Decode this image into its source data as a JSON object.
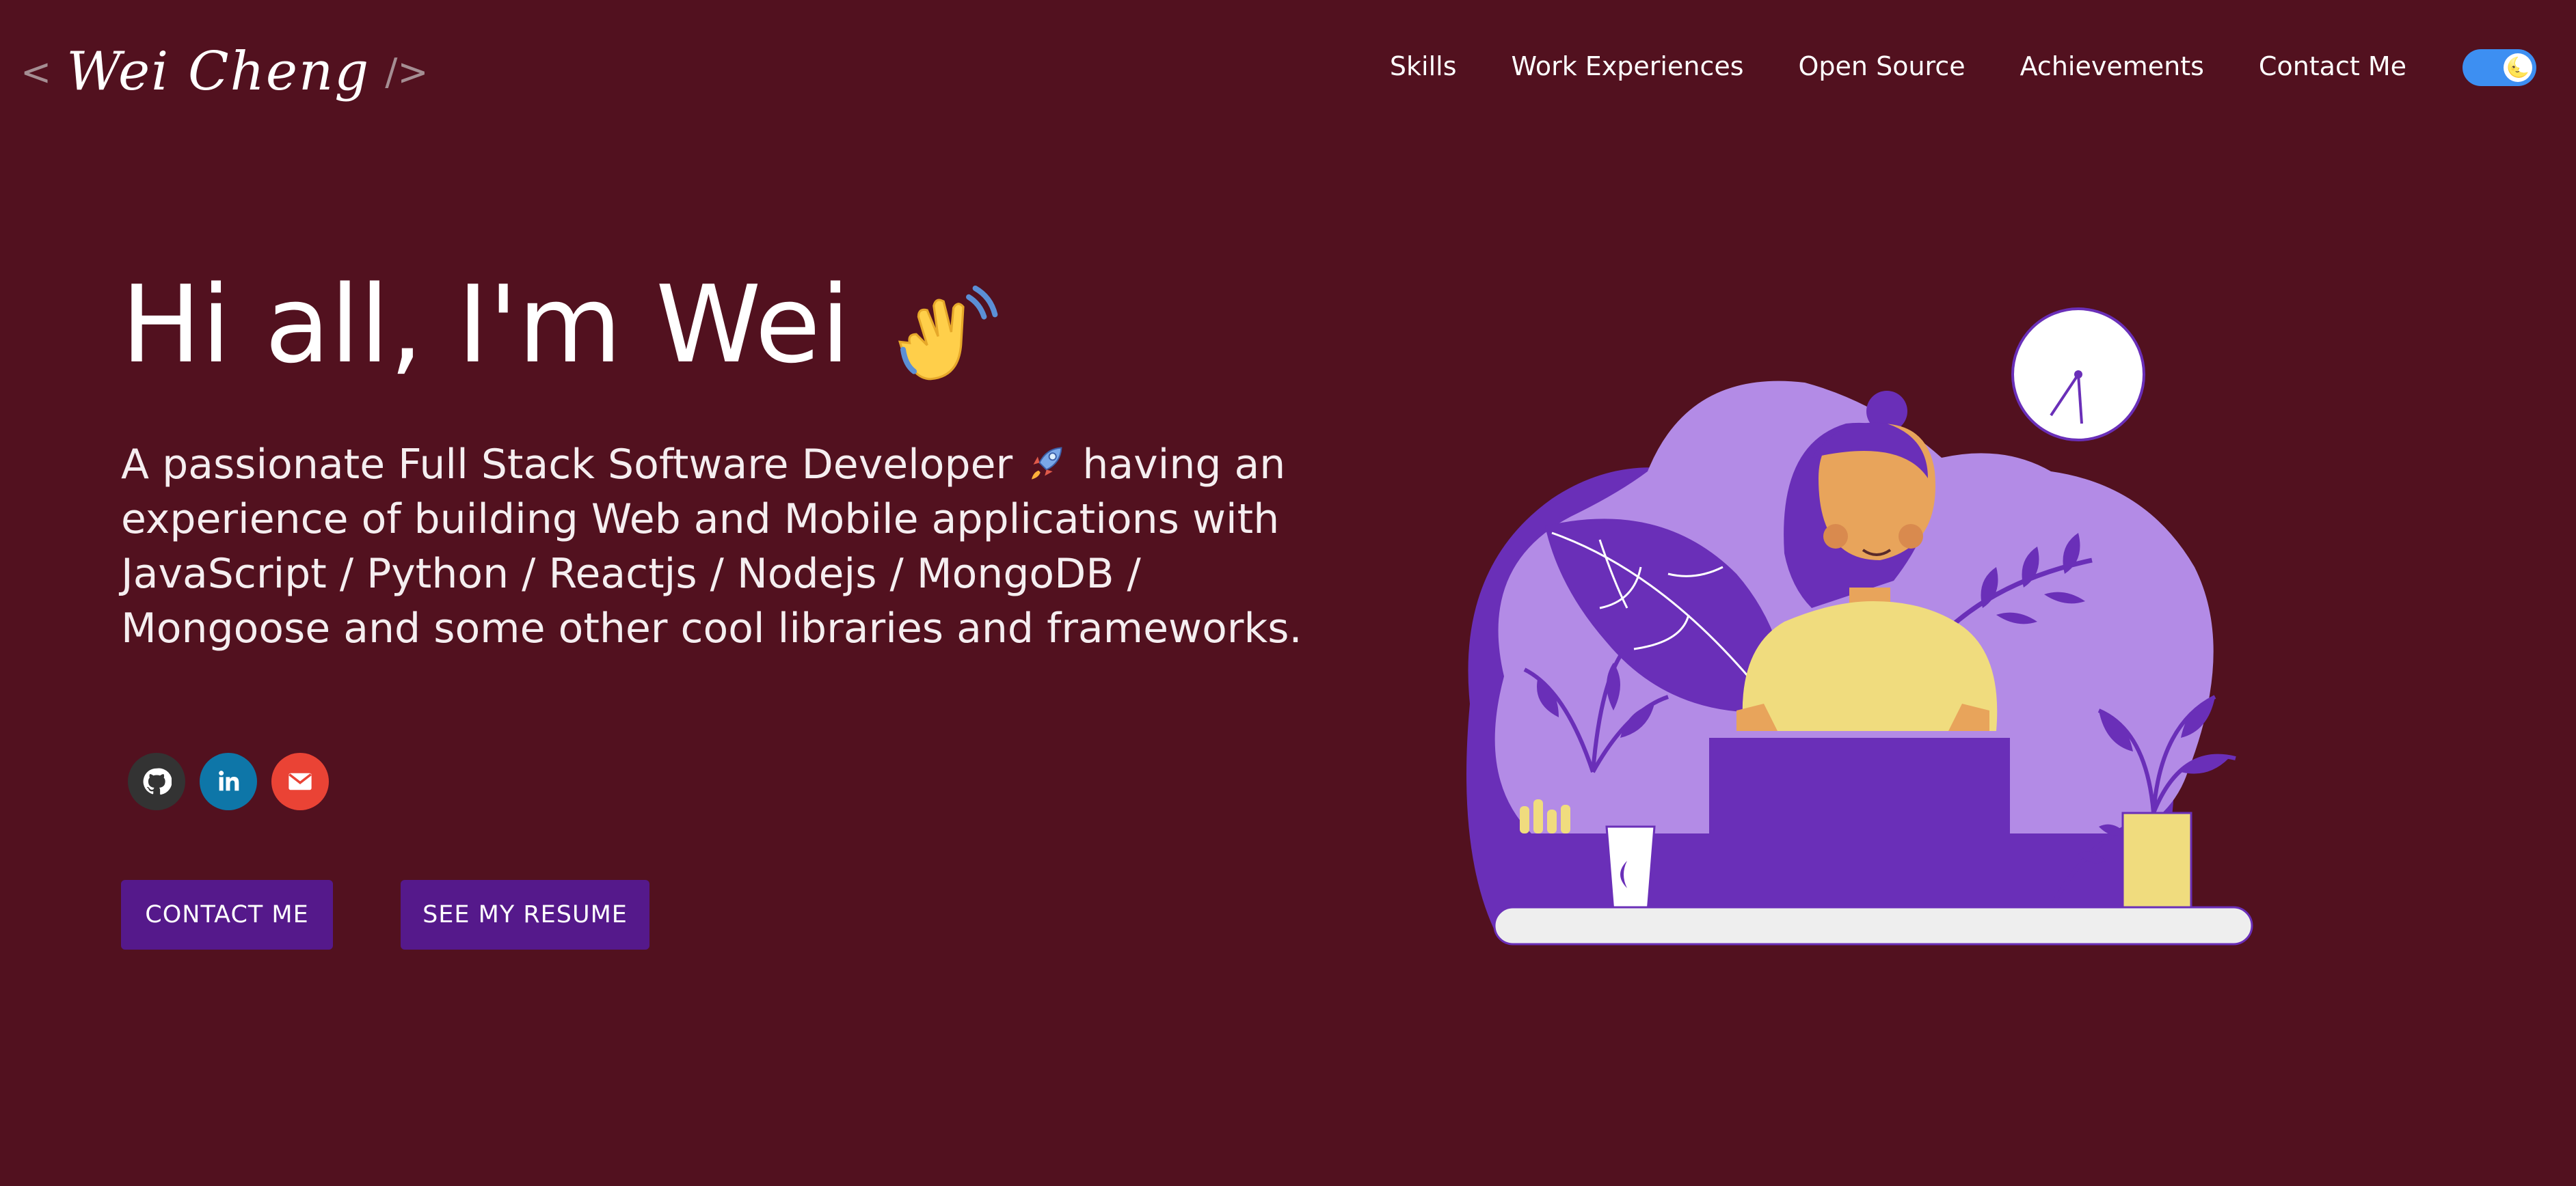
{
  "header": {
    "logo": {
      "open": "<",
      "name": "Wei Cheng",
      "close": "/>"
    },
    "nav": [
      "Skills",
      "Work Experiences",
      "Open Source",
      "Achievements",
      "Contact Me"
    ],
    "theme_toggle": {
      "knob_icon": "🌜"
    }
  },
  "hero": {
    "greeting": "Hi all, I'm Wei",
    "subtitle_part1": "A passionate Full Stack Software Developer",
    "subtitle_part2": "having an experience of building Web and Mobile applications with JavaScript / Python / Reactjs / Nodejs / MongoDB / Mongoose and some other cool libraries and frameworks.",
    "social_icons": [
      "github-icon",
      "linkedin-icon",
      "mail-icon"
    ],
    "buttons": {
      "contact": "CONTACT ME",
      "resume": "SEE MY RESUME"
    }
  },
  "colors": {
    "background": "#52111f",
    "button": "#55198b",
    "toggle": "#3d8ff2",
    "github": "#333333",
    "linkedin": "#0e76a8",
    "email": "#ea4335",
    "illustration_purple": "#6a2fb8",
    "illustration_lilac": "#b38be6",
    "illustration_yellow": "#f0dc7e"
  }
}
